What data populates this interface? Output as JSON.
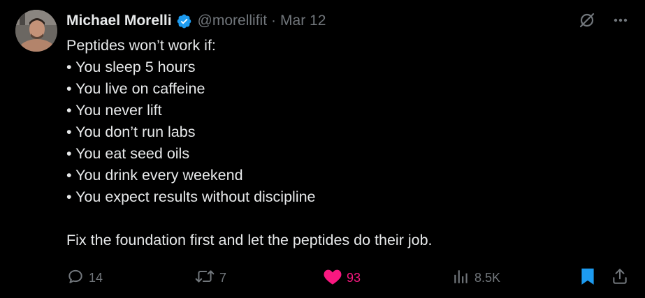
{
  "author": {
    "display_name": "Michael Morelli",
    "handle": "@morellifit",
    "separator": "·",
    "date": "Mar 12"
  },
  "tweet": {
    "intro": "Peptides won’t work if:",
    "bullets": [
      "• You sleep 5 hours",
      "• You live on caffeine",
      "• You never lift",
      "• You don’t run labs",
      "• You eat seed oils",
      "• You drink every weekend",
      "• You expect results without discipline"
    ],
    "closing": "Fix the foundation first and let the peptides do their job."
  },
  "actions": {
    "replies": "14",
    "reposts": "7",
    "likes": "93",
    "views": "8.5K"
  },
  "icons": {
    "verified": "verified-badge-icon",
    "grok": "grok-icon",
    "more": "more-icon",
    "reply": "reply-icon",
    "repost": "repost-icon",
    "like": "heart-icon",
    "views": "views-icon",
    "bookmark": "bookmark-icon",
    "share": "share-icon"
  },
  "colors": {
    "background": "#000000",
    "text": "#e7e9ea",
    "muted": "#71767b",
    "verified": "#1d9bf0",
    "like": "#f91880",
    "bookmark": "#1d9bf0"
  }
}
